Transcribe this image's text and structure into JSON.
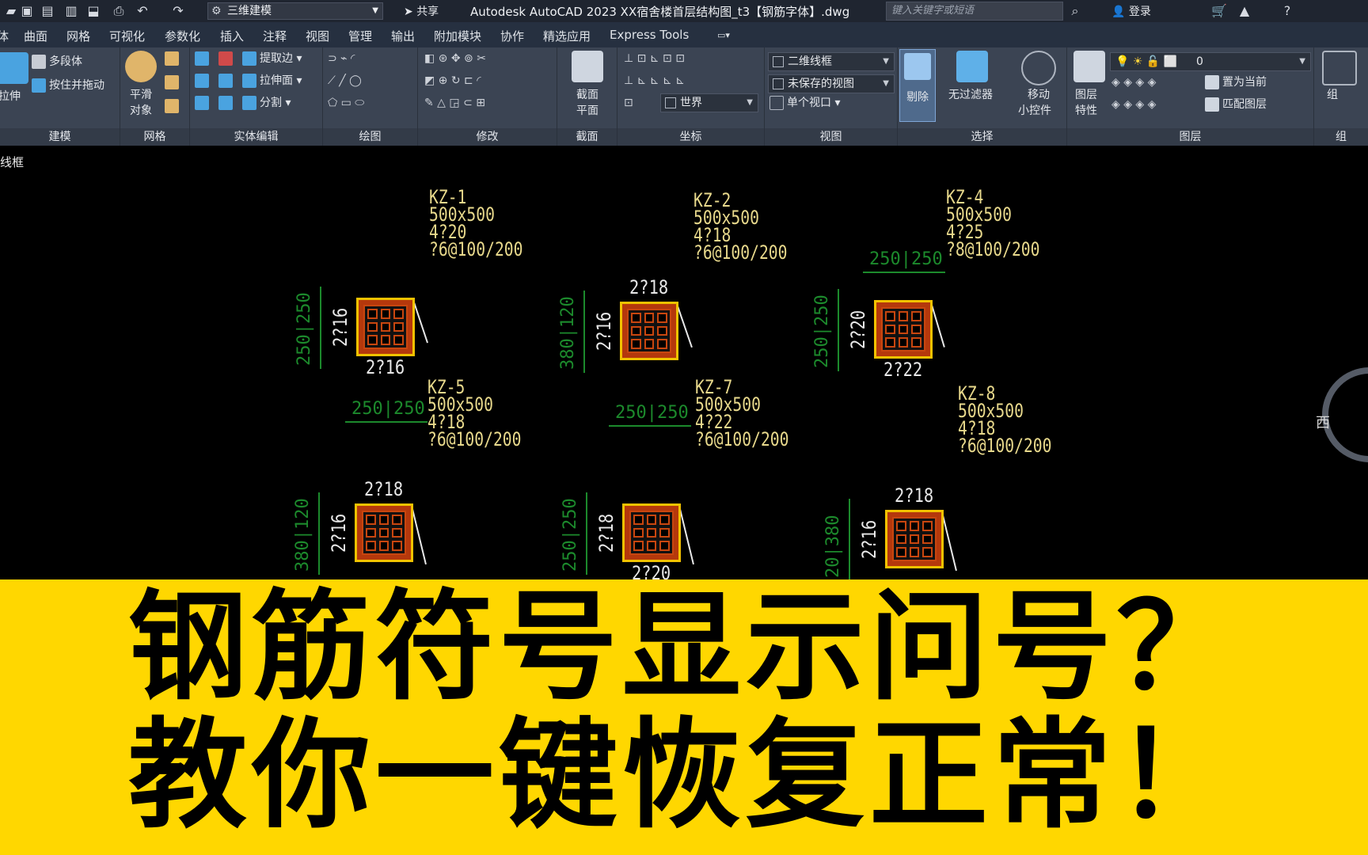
{
  "titlebar": {
    "workspace": "三维建模",
    "share": "共享",
    "title": "Autodesk AutoCAD 2023 XX宿舍楼首层结构图_t3【钢筋字体】.dwg",
    "search_placeholder": "键入关键字或短语",
    "login": "登录"
  },
  "menubar": {
    "items": [
      "体",
      "曲面",
      "网格",
      "可视化",
      "参数化",
      "插入",
      "注释",
      "视图",
      "管理",
      "输出",
      "附加模块",
      "协作",
      "精选应用",
      "Express Tools"
    ]
  },
  "ribbon": {
    "model": {
      "title": "建模",
      "stretch": "拉伸",
      "polysolid": "多段体",
      "presspull": "按住并拖动"
    },
    "mesh": {
      "title": "网格",
      "smooth": "平滑",
      "smooth2": "对象"
    },
    "solid_edit": {
      "title": "实体编辑",
      "extract": "提取边",
      "extrude_face": "拉伸面",
      "split": "分割"
    },
    "draw": {
      "title": "绘图"
    },
    "modify": {
      "title": "修改"
    },
    "section": {
      "title": "截面",
      "plane": "截面",
      "plane2": "平面"
    },
    "coord": {
      "title": "坐标",
      "world": "世界"
    },
    "view": {
      "title": "视图",
      "visual_style": "二维线框",
      "saved_view": "未保存的视图",
      "viewport": "单个视口"
    },
    "select": {
      "title": "选择",
      "cull": "剔除",
      "no_filter": "无过滤器",
      "gizmo": "移动",
      "gizmo2": "小控件"
    },
    "layers": {
      "title": "图层",
      "props": "图层",
      "props2": "特性",
      "current_layer": "0",
      "set_current": "置为当前",
      "match": "匹配图层"
    },
    "group": {
      "title": "组",
      "label": "组"
    }
  },
  "tab_label": "线框",
  "compass_label": "西",
  "columns": [
    {
      "id": "KZ-1",
      "lines": [
        "KZ-1",
        "500x500",
        "4?20",
        "?6@100/200"
      ],
      "top": "",
      "bottom": "2?16",
      "side": "2?16",
      "dim_v": "250|250",
      "dim_h": "250|250"
    },
    {
      "id": "KZ-2",
      "lines": [
        "KZ-2",
        "500x500",
        "4?18",
        "?6@100/200"
      ],
      "top": "2?18",
      "bottom": "",
      "side": "2?16",
      "dim_v": "380|120",
      "dim_h": "250|250"
    },
    {
      "id": "KZ-4",
      "lines": [
        "KZ-4",
        "500x500",
        "4?25",
        "?8@100/200"
      ],
      "top": "",
      "bottom": "2?22",
      "side": "2?20",
      "dim_v": "250|250",
      "dim_h": "250|250"
    },
    {
      "id": "KZ-5",
      "lines": [
        "KZ-5",
        "500x500",
        "4?18",
        "?6@100/200"
      ],
      "top": "2?18",
      "bottom": "",
      "side": "2?16",
      "dim_v": "380|120",
      "dim_h": ""
    },
    {
      "id": "KZ-7",
      "lines": [
        "KZ-7",
        "500x500",
        "4?22",
        "?6@100/200"
      ],
      "top": "",
      "bottom": "2?20",
      "side": "2?18",
      "dim_v": "250|250",
      "dim_h": ""
    },
    {
      "id": "KZ-8",
      "lines": [
        "KZ-8",
        "500x500",
        "4?18",
        "?6@100/200"
      ],
      "top": "2?18",
      "bottom": "",
      "side": "2?16",
      "dim_v": "20|380",
      "dim_h": ""
    }
  ],
  "banner": {
    "line1": "钢筋符号显示问号？",
    "line2": "教你一键恢复正常！"
  }
}
